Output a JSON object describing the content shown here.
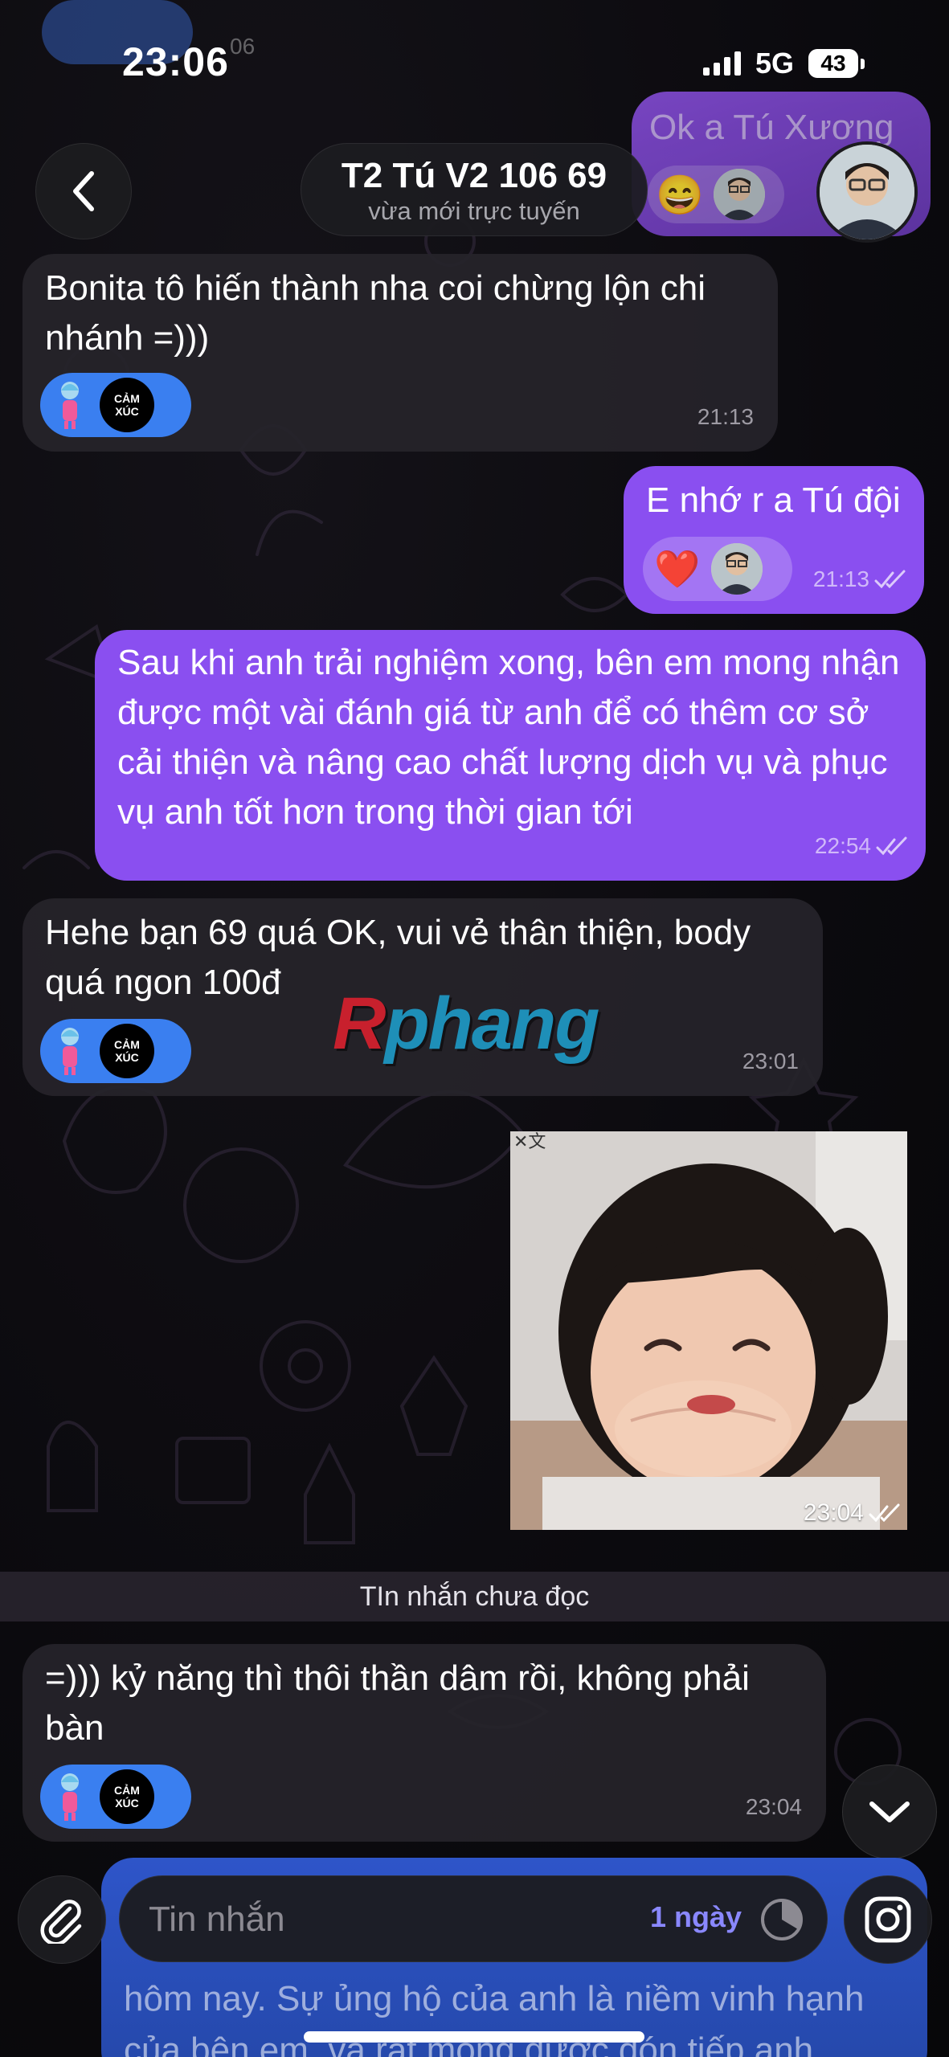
{
  "status_bar": {
    "time": "23:06",
    "network": "5G",
    "battery": "43"
  },
  "header": {
    "title": "T2 Tú V2 106 69",
    "subtitle": "vừa mới trực tuyến",
    "back_icon": "chevron-left-icon"
  },
  "pinned_preview": {
    "text": "Ok a Tú Xương",
    "reaction_emoji": "😄"
  },
  "ghost_time": "06",
  "reaction_badge": {
    "line1": "CẢM",
    "line2": "XÚC"
  },
  "messages": [
    {
      "direction": "in",
      "text": "Bonita tô hiến thành nha coi chừng lộn chi nhánh =)))",
      "time": "21:13"
    },
    {
      "direction": "out",
      "text": "E nhớ r a Tú đội",
      "reaction": "❤️",
      "time": "21:13"
    },
    {
      "direction": "out",
      "text": "Sau khi anh trải nghiệm xong, bên em mong nhận được một vài đánh giá từ anh để có thêm cơ sở cải thiện và nâng cao chất lượng dịch vụ và phục vụ anh tốt hơn trong thời gian tới",
      "time": "22:54"
    },
    {
      "direction": "in",
      "text": "Hehe bạn 69 quá OK, vui vẻ thân thiện, body quá ngon 100đ",
      "time": "23:01"
    },
    {
      "direction": "out",
      "type": "video",
      "time": "23:04"
    },
    {
      "direction": "in",
      "text": "=))) kỷ năng thì thôi thần dâm rồi, không phải bàn",
      "time": "23:04"
    }
  ],
  "watermark": {
    "first": "R",
    "rest": "phang"
  },
  "unread_divider": "TIn nhắn chưa đọc",
  "background_message": {
    "text": "hôm nay. Sự ủng hộ của anh là niềm vinh hạnh của bên em, và rất mong được đón tiếp anh"
  },
  "composer": {
    "placeholder": "Tin nhắn",
    "timer_label": "1 ngày"
  },
  "colors": {
    "outgoing_bubble": "#8a4ff0",
    "incoming_bubble": "#26242a",
    "reaction_blue": "#3a7ff0",
    "timer_accent": "#8a88ff"
  }
}
